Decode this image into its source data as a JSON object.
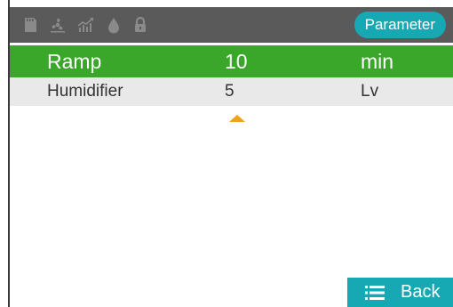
{
  "status_bar": {
    "icons": [
      "sd-card-icon",
      "fan-icon",
      "chart-icon",
      "water-drop-icon",
      "lock-icon"
    ],
    "parameter_button": "Parameter"
  },
  "rows": [
    {
      "name": "Ramp",
      "value": "10",
      "unit": "min",
      "selected": true
    },
    {
      "name": "Humidifier",
      "value": "5",
      "unit": "Lv",
      "selected": false
    }
  ],
  "back_button": {
    "label": "Back",
    "icon": "list-icon"
  },
  "colors": {
    "topbar": "#5a5a5a",
    "selected_row": "#3aa62a",
    "row": "#e9e9e9",
    "accent": "#16a9b4",
    "arrow": "#f0a31a"
  }
}
